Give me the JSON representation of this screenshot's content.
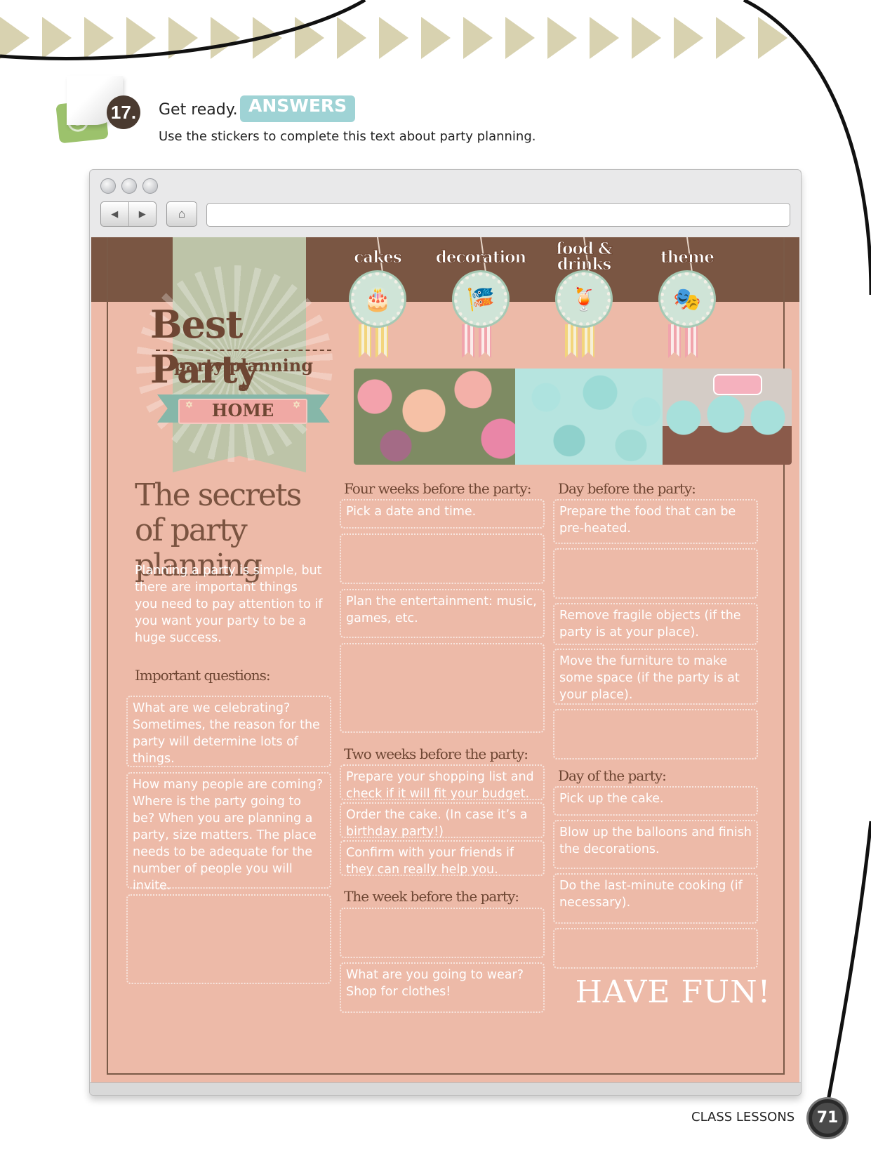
{
  "exercise": {
    "number": "17.",
    "title": "Get ready.",
    "badge": "ANSWERS",
    "instruction": "Use the stickers to complete this text about party planning.",
    "sticker_icon": "S"
  },
  "browser": {
    "back_icon": "◀",
    "forward_icon": "▶",
    "home_icon": "⌂",
    "url": ""
  },
  "site": {
    "logo": {
      "title": "Best Party",
      "subtitle": "party planning",
      "star": "★",
      "home": "HOME",
      "ornament": "✡"
    },
    "nav": [
      {
        "label": "cakes",
        "icon": "cake-icon",
        "glyph": "🎂"
      },
      {
        "label": "decoration",
        "icon": "bunting-icon",
        "glyph": "🎏"
      },
      {
        "label": "food & drinks",
        "icon": "drink-icon",
        "glyph": "🍹"
      },
      {
        "label": "theme",
        "icon": "mask-icon",
        "glyph": "🎭"
      }
    ],
    "heading": "The secrets of party planning",
    "intro": "Planning a party is simple, but there are important things you need to pay attention to if you want your party to be a huge success.",
    "important": {
      "title": "Important questions:",
      "items": [
        "What are we celebrating? Sometimes, the reason for the party will determine lots of things.",
        "How many people are coming? Where is the party going to be? When you are planning a party, size matters. The place needs to be adequate for the number of people you will invite.",
        ""
      ]
    },
    "four_weeks": {
      "title": "Four weeks before the party:",
      "items": [
        "Pick a date and time.",
        "",
        "Plan the entertainment: music, games, etc.",
        ""
      ]
    },
    "two_weeks": {
      "title": "Two weeks before the party:",
      "items": [
        "Prepare your shopping list and check if it will fit your budget.",
        "Order the cake. (In case it’s a birthday party!)",
        "Confirm with your friends if they can really help you."
      ]
    },
    "week_before": {
      "title": "The week before the party:",
      "items": [
        "",
        "What are you going to wear? Shop for clothes!"
      ]
    },
    "day_before": {
      "title": "Day before the party:",
      "items": [
        "Prepare the food that can be pre-heated.",
        "",
        "Remove fragile objects (if the party is at your place).",
        "Move the furniture to make some space (if the party is at your place).",
        ""
      ]
    },
    "day_of": {
      "title": "Day of the party:",
      "items": [
        "Pick up the cake.",
        "Blow up the balloons and finish the decorations.",
        "Do the last-minute cooking (if necessary).",
        ""
      ]
    },
    "closing": "HAVE FUN!"
  },
  "footer": {
    "section": "CLASS LESSONS",
    "page": "71"
  },
  "colors": {
    "site_bg": "#edbaa8",
    "band": "#7a5643",
    "answers_badge": "#9fd3d5",
    "heading": "#7a5340"
  }
}
